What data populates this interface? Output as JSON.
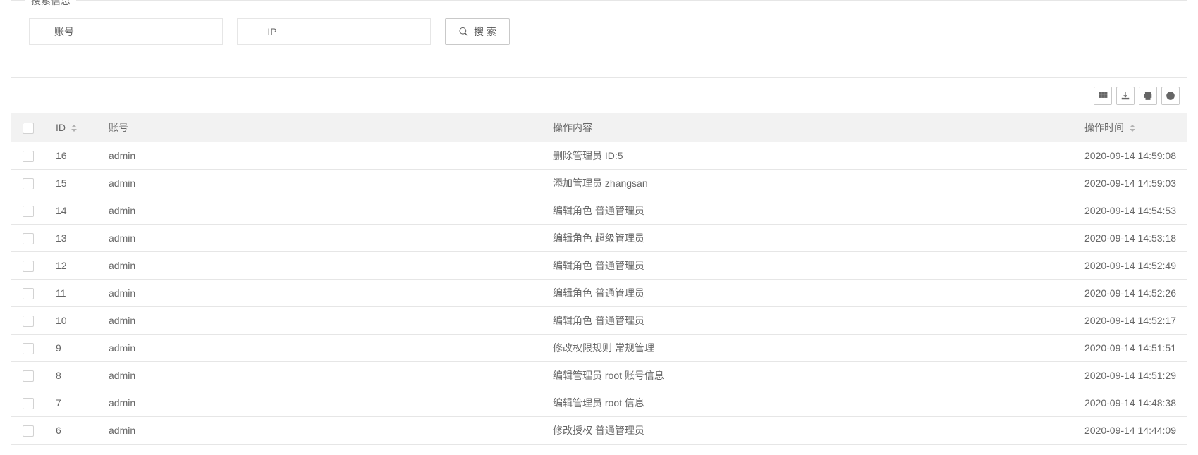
{
  "search": {
    "title": "搜索信息",
    "account_label": "账号",
    "ip_label": "IP",
    "account_value": "",
    "ip_value": "",
    "search_btn": "搜 索"
  },
  "table": {
    "headers": {
      "id": "ID",
      "account": "账号",
      "content": "操作内容",
      "time": "操作时间"
    },
    "rows": [
      {
        "id": "16",
        "account": "admin",
        "content": "删除管理员 ID:5",
        "time": "2020-09-14 14:59:08"
      },
      {
        "id": "15",
        "account": "admin",
        "content": "添加管理员 zhangsan",
        "time": "2020-09-14 14:59:03"
      },
      {
        "id": "14",
        "account": "admin",
        "content": "编辑角色 普通管理员",
        "time": "2020-09-14 14:54:53"
      },
      {
        "id": "13",
        "account": "admin",
        "content": "编辑角色 超级管理员",
        "time": "2020-09-14 14:53:18"
      },
      {
        "id": "12",
        "account": "admin",
        "content": "编辑角色 普通管理员",
        "time": "2020-09-14 14:52:49"
      },
      {
        "id": "11",
        "account": "admin",
        "content": "编辑角色 普通管理员",
        "time": "2020-09-14 14:52:26"
      },
      {
        "id": "10",
        "account": "admin",
        "content": "编辑角色 普通管理员",
        "time": "2020-09-14 14:52:17"
      },
      {
        "id": "9",
        "account": "admin",
        "content": "修改权限规则 常规管理",
        "time": "2020-09-14 14:51:51"
      },
      {
        "id": "8",
        "account": "admin",
        "content": "编辑管理员 root 账号信息",
        "time": "2020-09-14 14:51:29"
      },
      {
        "id": "7",
        "account": "admin",
        "content": "编辑管理员 root 信息",
        "time": "2020-09-14 14:48:38"
      },
      {
        "id": "6",
        "account": "admin",
        "content": "修改授权 普通管理员",
        "time": "2020-09-14 14:44:09"
      }
    ]
  }
}
